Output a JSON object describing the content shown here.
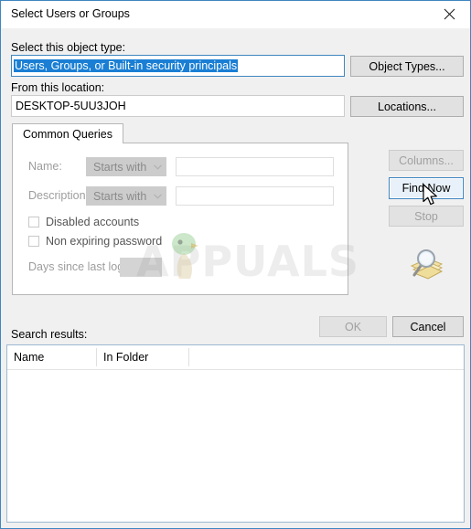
{
  "window": {
    "title": "Select Users or Groups",
    "close_icon": "close-icon",
    "accent_color": "#3f86c0",
    "body_color": "#f0f0f0"
  },
  "object_type": {
    "label": "Select this object type:",
    "value": "Users, Groups, or Built-in security principals",
    "selected": true,
    "button_label": "Object Types..."
  },
  "location": {
    "label": "From this location:",
    "value": "DESKTOP-5UU3JOH",
    "button_label": "Locations..."
  },
  "tabs": [
    {
      "label": "Common Queries",
      "active": true
    }
  ],
  "query_form": {
    "name": {
      "label": "Name:",
      "condition": "Starts with",
      "value": "",
      "disabled": true
    },
    "description": {
      "label": "Description:",
      "condition": "Starts with",
      "value": "",
      "disabled": true
    },
    "disabled_accounts": {
      "label": "Disabled accounts",
      "checked": false
    },
    "non_expiring_password": {
      "label": "Non expiring password",
      "checked": false
    },
    "days_since_last_logon": {
      "label": "Days since last logon:",
      "value": "",
      "disabled": true
    }
  },
  "side_buttons": {
    "columns": {
      "label": "Columns...",
      "disabled": true
    },
    "find_now": {
      "label": "Find Now",
      "disabled": false,
      "focused": true
    },
    "stop": {
      "label": "Stop",
      "disabled": true
    },
    "search_icon": "magnifier-folder-icon"
  },
  "footer": {
    "ok": {
      "label": "OK",
      "disabled": true
    },
    "cancel": {
      "label": "Cancel",
      "disabled": false
    }
  },
  "results": {
    "label": "Search results:",
    "columns": [
      "Name",
      "In Folder"
    ],
    "rows": []
  },
  "watermark": {
    "text": "APPUALS"
  },
  "cursor": {
    "type": "arrow-pointer"
  }
}
